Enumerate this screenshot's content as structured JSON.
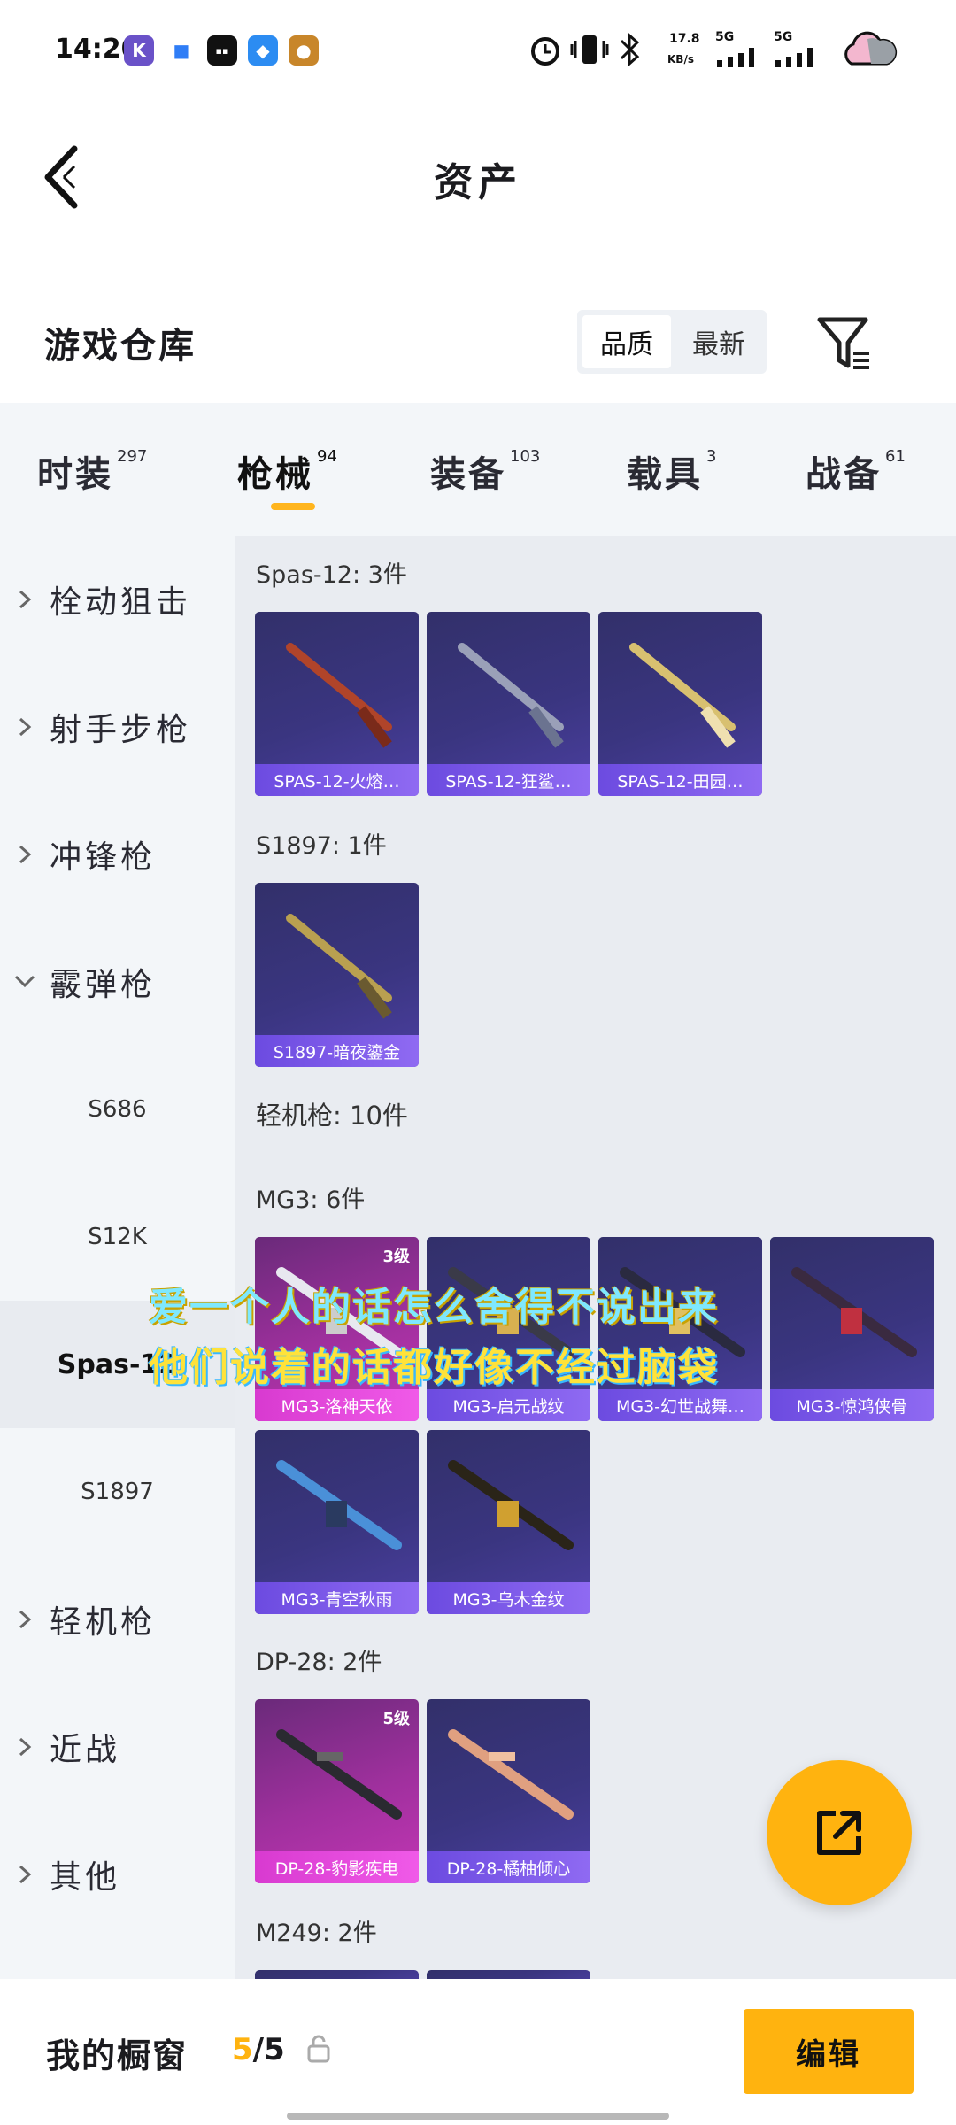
{
  "status_bar": {
    "time": "14:20",
    "net_speed": "17.8",
    "net_unit": "KB/s",
    "sig1": "5G",
    "sig2": "5G"
  },
  "header": {
    "title": "资产"
  },
  "section": {
    "title": "游戏仓库",
    "sort_options": [
      "品质",
      "最新"
    ]
  },
  "tabs": [
    {
      "label": "时装",
      "count": "297"
    },
    {
      "label": "枪械",
      "count": "94"
    },
    {
      "label": "装备",
      "count": "103"
    },
    {
      "label": "载具",
      "count": "3"
    },
    {
      "label": "战备",
      "count": "61"
    }
  ],
  "sidenav": {
    "items": [
      "栓动狙击",
      "射手步枪",
      "冲锋枪",
      "霰弹枪"
    ],
    "sub_items": [
      "S686",
      "S12K",
      "Spas-12",
      "S1897"
    ],
    "items_after": [
      "轻机枪",
      "近战",
      "其他"
    ]
  },
  "content": {
    "groups": [
      {
        "title": "Spas-12: 3件",
        "cards": [
          "SPAS-12-火熔…",
          "SPAS-12-狂鲨…",
          "SPAS-12-田园…"
        ]
      },
      {
        "title": "S1897: 1件",
        "cards": [
          "S1897-暗夜鎏金"
        ]
      },
      {
        "title": "轻机枪: 10件"
      },
      {
        "title": "MG3: 6件",
        "cards": [
          "MG3-洛神天依",
          "MG3-启元战纹",
          "MG3-幻世战舞…",
          "MG3-惊鸿侠骨",
          "MG3-青空秋雨",
          "MG3-乌木金纹"
        ],
        "levels": [
          "3级"
        ]
      },
      {
        "title": "DP-28: 2件",
        "cards": [
          "DP-28-豹影疾电",
          "DP-28-橘柚倾心"
        ],
        "levels": [
          "5级"
        ]
      },
      {
        "title": "M249: 2件"
      }
    ]
  },
  "overlay": {
    "line1": "爱一个人的话怎么舍得不说出来",
    "line2": "他们说着的话都好像不经过脑袋"
  },
  "bottom_bar": {
    "label": "我的橱窗",
    "count_used": "5",
    "count_total": "/5",
    "edit_label": "编辑"
  },
  "colors": {
    "accent": "#ffb30f",
    "card_purple": "#3a3580",
    "card_pink": "#c236b4"
  }
}
